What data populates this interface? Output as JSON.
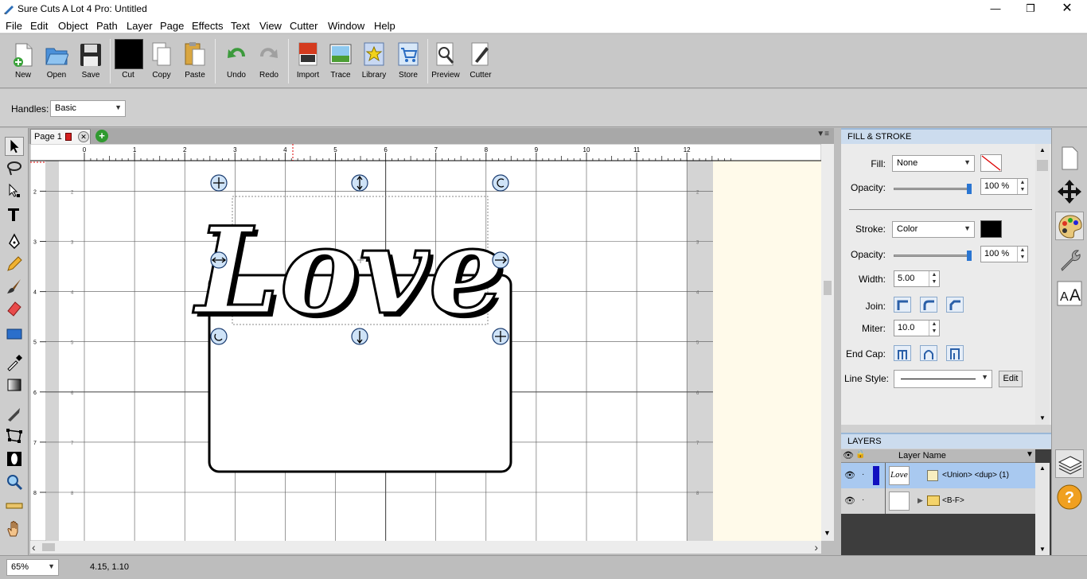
{
  "window": {
    "title": "Sure Cuts A Lot 4 Pro: Untitled"
  },
  "menu": [
    "File",
    "Edit",
    "Object",
    "Path",
    "Layer",
    "Page",
    "Effects",
    "Text",
    "View",
    "Cutter",
    "Window",
    "Help"
  ],
  "toolbar": {
    "new": "New",
    "open": "Open",
    "save": "Save",
    "cut": "Cut",
    "copy": "Copy",
    "paste": "Paste",
    "undo": "Undo",
    "redo": "Redo",
    "import": "Import",
    "trace": "Trace",
    "library": "Library",
    "store": "Store",
    "preview": "Preview",
    "cutter": "Cutter"
  },
  "options": {
    "handles_label": "Handles:",
    "handles_value": "Basic"
  },
  "page_tab": {
    "label": "Page 1"
  },
  "ruler": {
    "h_ticks": [
      "0",
      "1",
      "2",
      "3",
      "4",
      "5",
      "6",
      "7",
      "8",
      "9",
      "10",
      "11",
      "12"
    ],
    "v_ticks": [
      "2",
      "3",
      "4",
      "5",
      "6",
      "7",
      "8"
    ]
  },
  "canvas": {
    "text": "Love"
  },
  "status": {
    "zoom": "65%",
    "coords": "4.15, 1.10"
  },
  "fill_stroke": {
    "header": "FILL & STROKE",
    "fill_label": "Fill:",
    "fill_value": "None",
    "opacity_label": "Opacity:",
    "fill_opacity": "100 %",
    "stroke_label": "Stroke:",
    "stroke_value": "Color",
    "stroke_color": "#000000",
    "stroke_opacity": "100 %",
    "width_label": "Width:",
    "width_value": "5.00",
    "join_label": "Join:",
    "miter_label": "Miter:",
    "miter_value": "10.0",
    "endcap_label": "End Cap:",
    "linestyle_label": "Line Style:",
    "edit_label": "Edit"
  },
  "layers": {
    "header": "LAYERS",
    "column": "Layer Name",
    "rows": [
      {
        "name": "<Union> <dup> (1)",
        "color": "#1010c0",
        "selected": true
      },
      {
        "name": "<B-F>",
        "color": "",
        "selected": false
      }
    ]
  }
}
